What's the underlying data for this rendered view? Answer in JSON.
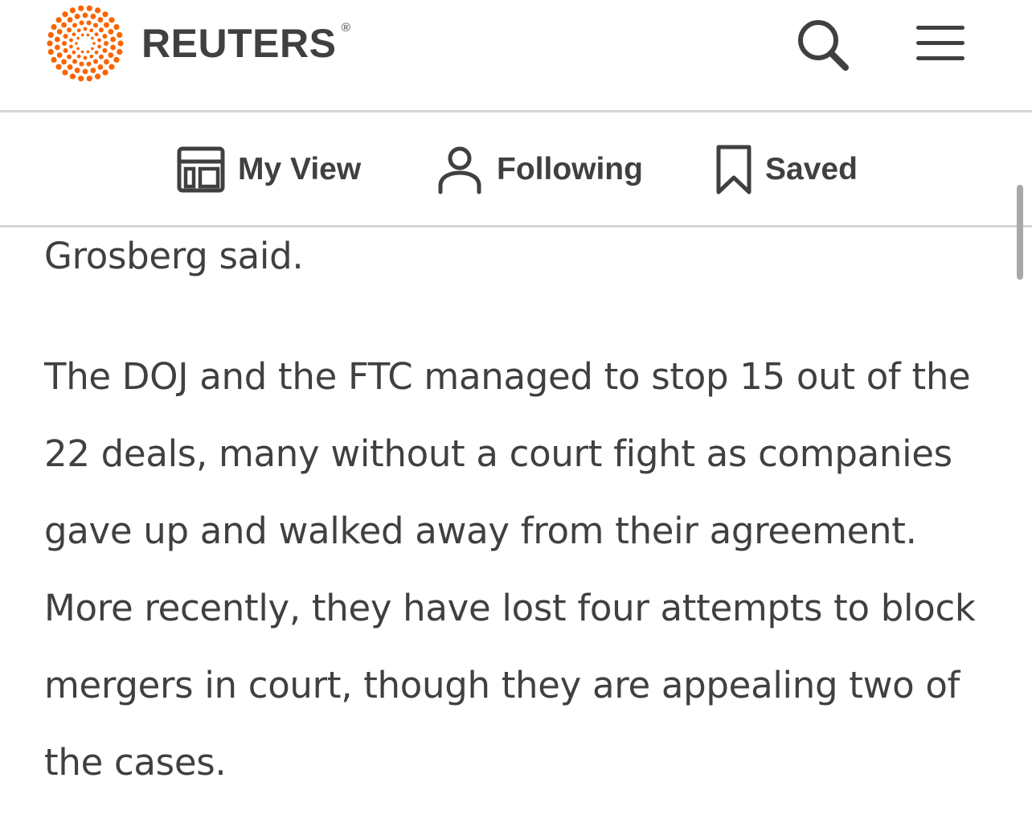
{
  "header": {
    "brand": "REUTERS",
    "registered_mark": "®",
    "brand_color": "#fa6400",
    "search_icon": "search-icon",
    "menu_icon": "hamburger-menu-icon"
  },
  "subnav": {
    "items": [
      {
        "label": "My View",
        "icon": "layout-icon"
      },
      {
        "label": "Following",
        "icon": "person-icon"
      },
      {
        "label": "Saved",
        "icon": "bookmark-icon"
      }
    ]
  },
  "article": {
    "paragraphs": [
      "Grosberg said.",
      "The DOJ and the FTC managed to stop 15 out of the 22 deals, many without a court fight as companies gave up and walked away from their agreement. More recently, they have lost four attempts to block mergers in court, though they are appealing two of the cases."
    ]
  },
  "colors": {
    "text": "#404040",
    "divider": "#d6d6d6",
    "background": "#ffffff"
  }
}
